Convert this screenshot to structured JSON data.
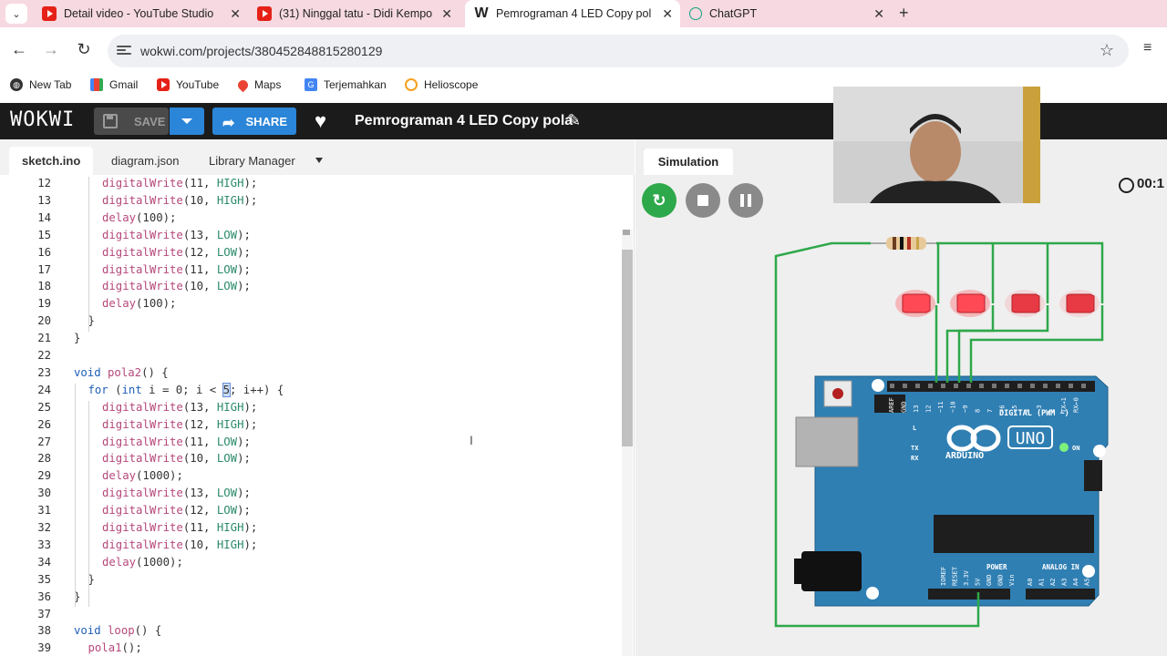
{
  "browser": {
    "tabs": [
      {
        "title": "Detail video - YouTube Studio",
        "icon": "youtube-icon"
      },
      {
        "title": "(31) Ninggal tatu - Didi Kempo",
        "icon": "youtube-icon"
      },
      {
        "title": "Pemrograman 4 LED Copy pola",
        "icon": "wokwi-icon"
      },
      {
        "title": "ChatGPT",
        "icon": "chatgpt-icon"
      }
    ],
    "active_tab": 2,
    "url": "wokwi.com/projects/380452848815280129",
    "bookmarks": [
      {
        "label": "New Tab",
        "icon": "globe-icon"
      },
      {
        "label": "Gmail",
        "icon": "gmail-icon"
      },
      {
        "label": "YouTube",
        "icon": "youtube-icon"
      },
      {
        "label": "Maps",
        "icon": "maps-icon"
      },
      {
        "label": "Terjemahkan",
        "icon": "translate-icon"
      },
      {
        "label": "Helioscope",
        "icon": "helioscope-icon"
      }
    ]
  },
  "wokwi": {
    "logo": "WOKWI",
    "save_label": "SAVE",
    "share_label": "SHARE",
    "project_title": "Pemrograman 4 LED Copy pola",
    "editor_tabs": [
      "sketch.ino",
      "diagram.json",
      "Library Manager"
    ],
    "active_editor_tab": 0,
    "simulation_tab": "Simulation",
    "timer": "00:1"
  },
  "code": {
    "lines": [
      {
        "n": "12",
        "indent": 2,
        "text": "digitalWrite(11, HIGH);"
      },
      {
        "n": "13",
        "indent": 2,
        "text": "digitalWrite(10, HIGH);"
      },
      {
        "n": "14",
        "indent": 2,
        "text": "delay(100);"
      },
      {
        "n": "15",
        "indent": 2,
        "text": "digitalWrite(13, LOW);"
      },
      {
        "n": "16",
        "indent": 2,
        "text": "digitalWrite(12, LOW);"
      },
      {
        "n": "17",
        "indent": 2,
        "text": "digitalWrite(11, LOW);"
      },
      {
        "n": "18",
        "indent": 2,
        "text": "digitalWrite(10, LOW);"
      },
      {
        "n": "19",
        "indent": 2,
        "text": "delay(100);"
      },
      {
        "n": "20",
        "indent": 1,
        "text": "}"
      },
      {
        "n": "21",
        "indent": 0,
        "text": "}"
      },
      {
        "n": "22",
        "indent": 0,
        "text": ""
      },
      {
        "n": "23",
        "indent": 0,
        "text": "void pola2() {"
      },
      {
        "n": "24",
        "indent": 1,
        "text": "for (int i = 0; i < 5; i++) {"
      },
      {
        "n": "25",
        "indent": 2,
        "text": "digitalWrite(13, HIGH);"
      },
      {
        "n": "26",
        "indent": 2,
        "text": "digitalWrite(12, HIGH);"
      },
      {
        "n": "27",
        "indent": 2,
        "text": "digitalWrite(11, LOW);"
      },
      {
        "n": "28",
        "indent": 2,
        "text": "digitalWrite(10, LOW);"
      },
      {
        "n": "29",
        "indent": 2,
        "text": "delay(1000);"
      },
      {
        "n": "30",
        "indent": 2,
        "text": "digitalWrite(13, LOW);"
      },
      {
        "n": "31",
        "indent": 2,
        "text": "digitalWrite(12, LOW);"
      },
      {
        "n": "32",
        "indent": 2,
        "text": "digitalWrite(11, HIGH);"
      },
      {
        "n": "33",
        "indent": 2,
        "text": "digitalWrite(10, HIGH);"
      },
      {
        "n": "34",
        "indent": 2,
        "text": "delay(1000);"
      },
      {
        "n": "35",
        "indent": 1,
        "text": "}"
      },
      {
        "n": "36",
        "indent": 0,
        "text": "}"
      },
      {
        "n": "37",
        "indent": 0,
        "text": ""
      },
      {
        "n": "38",
        "indent": 0,
        "text": "void loop() {"
      },
      {
        "n": "39",
        "indent": 1,
        "text": "pola1();"
      }
    ]
  },
  "board": {
    "name": "ARDUINO",
    "model": "UNO",
    "digital_label": "DIGITAL (PWM ~)",
    "power_label": "POWER",
    "analog_label": "ANALOG IN",
    "on_label": "ON",
    "l_label": "L",
    "tx_label": "TX",
    "rx_label": "RX",
    "top_pins": [
      "AREF",
      "GND",
      "13",
      "12",
      "~11",
      "~10",
      "~9",
      "8",
      "7",
      "~6",
      "~5",
      "4",
      "~3",
      "2",
      "TX→1",
      "RX←0"
    ],
    "bottom_pins": [
      "IOREF",
      "RESET",
      "3.3V",
      "5V",
      "GND",
      "GND",
      "Vin",
      "A0",
      "A1",
      "A2",
      "A3",
      "A4",
      "A5"
    ],
    "led_count": 4
  },
  "colors": {
    "wokwi_header": "#1b1b1b",
    "accent_blue": "#2b85d8",
    "board_blue": "#2f7fb3",
    "wire_green": "#2ea84a",
    "led_red": "#f0343c",
    "tabstrip_pink": "#f6d9e1"
  }
}
